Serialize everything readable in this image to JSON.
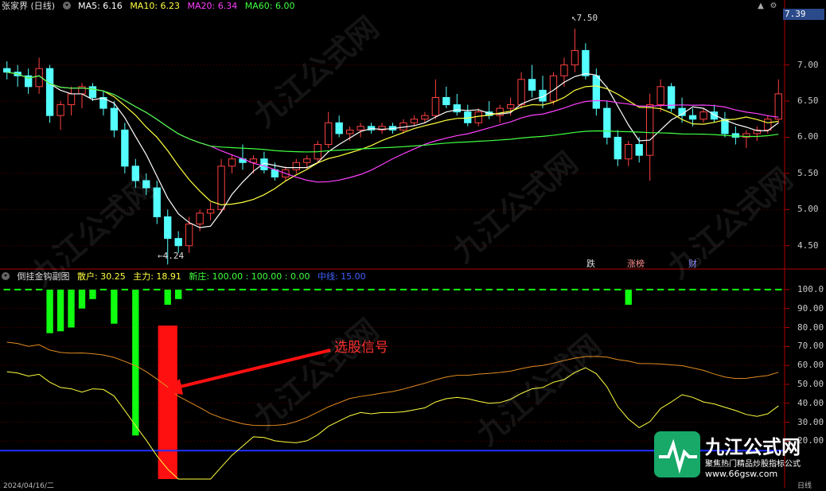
{
  "main_panel": {
    "title": "张家界 (日线)",
    "ma5": "MA5: 6.16",
    "ma10": "MA10: 6.23",
    "ma20": "MA20: 6.34",
    "ma60": "MA60: 6.00",
    "price_tag": "7.39",
    "high_label": "7.50",
    "low_label": "4.24",
    "y_ticks": [
      "7.00",
      "6.50",
      "6.00",
      "5.50",
      "5.00",
      "4.50"
    ],
    "flags": [
      "跌",
      "涨榜",
      "财"
    ]
  },
  "sub_panel": {
    "title": "倒挂金钩副图",
    "sanhu": "散户: 30.25",
    "zhuli": "主力: 18.91",
    "xinzhuang": "新庄: 100.00 : 100.00 : 0.00",
    "zhongxian": "中线: 15.00",
    "y_ticks": [
      "100.0",
      "90.00",
      "80.00",
      "70.00",
      "60.00",
      "50.00",
      "40.00",
      "30.00",
      "20.00"
    ],
    "annotation": "选股信号"
  },
  "footer": {
    "date": "2024/04/16/二",
    "period": "日线"
  },
  "watermark": {
    "text": "九江公式网",
    "sub": "聚焦热门精品炒股指标公式",
    "url": "www.66gsw.com"
  },
  "colors": {
    "up": "#ff4040",
    "down": "#54ffff",
    "ma5": "#ffffff",
    "ma10": "#ffff40",
    "ma20": "#ff40ff",
    "ma60": "#40ff40",
    "signal": "#ff1010",
    "green_bar": "#10ff10",
    "midline": "#2030ff"
  },
  "chart_data": [
    {
      "type": "candlestick",
      "title": "张家界 (日线)",
      "ylim": [
        4.2,
        7.7
      ],
      "candles": [
        [
          6.95,
          7.05,
          6.8,
          6.9
        ],
        [
          6.9,
          7.0,
          6.7,
          6.85
        ],
        [
          6.85,
          6.95,
          6.6,
          6.7
        ],
        [
          6.7,
          7.1,
          6.6,
          6.95
        ],
        [
          6.95,
          7.0,
          6.2,
          6.3
        ],
        [
          6.3,
          6.5,
          6.1,
          6.45
        ],
        [
          6.45,
          6.7,
          6.3,
          6.6
        ],
        [
          6.6,
          6.75,
          6.4,
          6.7
        ],
        [
          6.7,
          6.75,
          6.5,
          6.55
        ],
        [
          6.55,
          6.65,
          6.3,
          6.4
        ],
        [
          6.4,
          6.5,
          6.0,
          6.1
        ],
        [
          6.1,
          6.2,
          5.5,
          5.6
        ],
        [
          5.6,
          5.7,
          5.3,
          5.4
        ],
        [
          5.4,
          5.5,
          5.2,
          5.3
        ],
        [
          5.3,
          5.4,
          4.8,
          4.9
        ],
        [
          4.9,
          5.0,
          4.24,
          4.6
        ],
        [
          4.6,
          4.7,
          4.4,
          4.5
        ],
        [
          4.5,
          4.9,
          4.4,
          4.8
        ],
        [
          4.8,
          5.0,
          4.7,
          4.95
        ],
        [
          4.95,
          5.1,
          4.85,
          5.0
        ],
        [
          5.0,
          5.7,
          4.95,
          5.6
        ],
        [
          5.6,
          5.75,
          5.5,
          5.7
        ],
        [
          5.7,
          5.9,
          5.55,
          5.65
        ],
        [
          5.65,
          5.75,
          5.5,
          5.7
        ],
        [
          5.7,
          5.8,
          5.5,
          5.55
        ],
        [
          5.55,
          5.65,
          5.4,
          5.45
        ],
        [
          5.45,
          5.6,
          5.4,
          5.55
        ],
        [
          5.55,
          5.7,
          5.5,
          5.65
        ],
        [
          5.65,
          5.75,
          5.55,
          5.7
        ],
        [
          5.7,
          5.95,
          5.65,
          5.9
        ],
        [
          5.9,
          6.35,
          5.85,
          6.2
        ],
        [
          6.2,
          6.3,
          6.0,
          6.05
        ],
        [
          6.05,
          6.15,
          5.95,
          6.1
        ],
        [
          6.1,
          6.2,
          6.0,
          6.15
        ],
        [
          6.15,
          6.2,
          6.05,
          6.1
        ],
        [
          6.1,
          6.2,
          6.05,
          6.15
        ],
        [
          6.15,
          6.2,
          6.05,
          6.1
        ],
        [
          6.1,
          6.25,
          6.05,
          6.2
        ],
        [
          6.2,
          6.3,
          6.15,
          6.25
        ],
        [
          6.25,
          6.35,
          6.2,
          6.3
        ],
        [
          6.3,
          6.8,
          6.25,
          6.55
        ],
        [
          6.55,
          6.7,
          6.4,
          6.45
        ],
        [
          6.45,
          6.6,
          6.3,
          6.35
        ],
        [
          6.35,
          6.45,
          6.15,
          6.2
        ],
        [
          6.2,
          6.4,
          6.15,
          6.35
        ],
        [
          6.35,
          6.5,
          6.25,
          6.3
        ],
        [
          6.3,
          6.45,
          6.2,
          6.4
        ],
        [
          6.4,
          6.55,
          6.3,
          6.45
        ],
        [
          6.45,
          6.9,
          6.4,
          6.8
        ],
        [
          6.8,
          7.0,
          6.55,
          6.65
        ],
        [
          6.65,
          6.85,
          6.4,
          6.5
        ],
        [
          6.5,
          6.9,
          6.45,
          6.85
        ],
        [
          6.85,
          7.1,
          6.7,
          7.0
        ],
        [
          7.0,
          7.5,
          6.9,
          7.2
        ],
        [
          7.2,
          7.3,
          6.8,
          6.85
        ],
        [
          6.85,
          6.95,
          6.3,
          6.4
        ],
        [
          6.4,
          6.5,
          5.9,
          6.0
        ],
        [
          6.0,
          6.1,
          5.6,
          5.7
        ],
        [
          5.7,
          5.95,
          5.6,
          5.9
        ],
        [
          5.9,
          6.0,
          5.65,
          5.75
        ],
        [
          5.75,
          6.6,
          5.4,
          6.45
        ],
        [
          6.45,
          6.8,
          6.35,
          6.7
        ],
        [
          6.7,
          6.75,
          6.35,
          6.4
        ],
        [
          6.4,
          6.55,
          6.2,
          6.3
        ],
        [
          6.3,
          6.4,
          6.15,
          6.25
        ],
        [
          6.25,
          6.4,
          6.2,
          6.35
        ],
        [
          6.35,
          6.45,
          6.2,
          6.25
        ],
        [
          6.25,
          6.35,
          6.0,
          6.05
        ],
        [
          6.05,
          6.15,
          5.9,
          6.0
        ],
        [
          6.0,
          6.1,
          5.85,
          6.05
        ],
        [
          6.05,
          6.15,
          5.95,
          6.1
        ],
        [
          6.1,
          6.3,
          6.05,
          6.25
        ],
        [
          6.25,
          6.8,
          6.2,
          6.6
        ]
      ]
    },
    {
      "type": "bar",
      "title": "倒挂金钩副图",
      "ylim": [
        0,
        105
      ],
      "green_bars_top": [
        100,
        100,
        100,
        100,
        100,
        100,
        100,
        100,
        100,
        100,
        100,
        100,
        100,
        100,
        100,
        100,
        100,
        100,
        100,
        100,
        100,
        100,
        100,
        100,
        100,
        100,
        100,
        100,
        100,
        100,
        100,
        100,
        100,
        100,
        100,
        100,
        100,
        100,
        100,
        100,
        100,
        100,
        100,
        100,
        100,
        100,
        100,
        100,
        100,
        100,
        100,
        100,
        100,
        100,
        100,
        100,
        100,
        100,
        100,
        100,
        100,
        100,
        100,
        100,
        100,
        100,
        100,
        100,
        100,
        100,
        100,
        100,
        100
      ],
      "green_bars_bottom": [
        100,
        100,
        100,
        100,
        77,
        78,
        80,
        90,
        95,
        100,
        82,
        100,
        23,
        100,
        100,
        92,
        95,
        100,
        100,
        100,
        100,
        100,
        100,
        100,
        100,
        100,
        100,
        100,
        100,
        100,
        100,
        100,
        100,
        100,
        100,
        100,
        100,
        100,
        100,
        100,
        100,
        100,
        100,
        100,
        100,
        100,
        100,
        100,
        100,
        100,
        100,
        100,
        100,
        100,
        100,
        100,
        100,
        100,
        92,
        100,
        100,
        100,
        100,
        100,
        100,
        100,
        100,
        100,
        100,
        100,
        100,
        100,
        100
      ],
      "signal_bar": {
        "index": 15,
        "top": 81,
        "bottom": 0
      }
    }
  ]
}
